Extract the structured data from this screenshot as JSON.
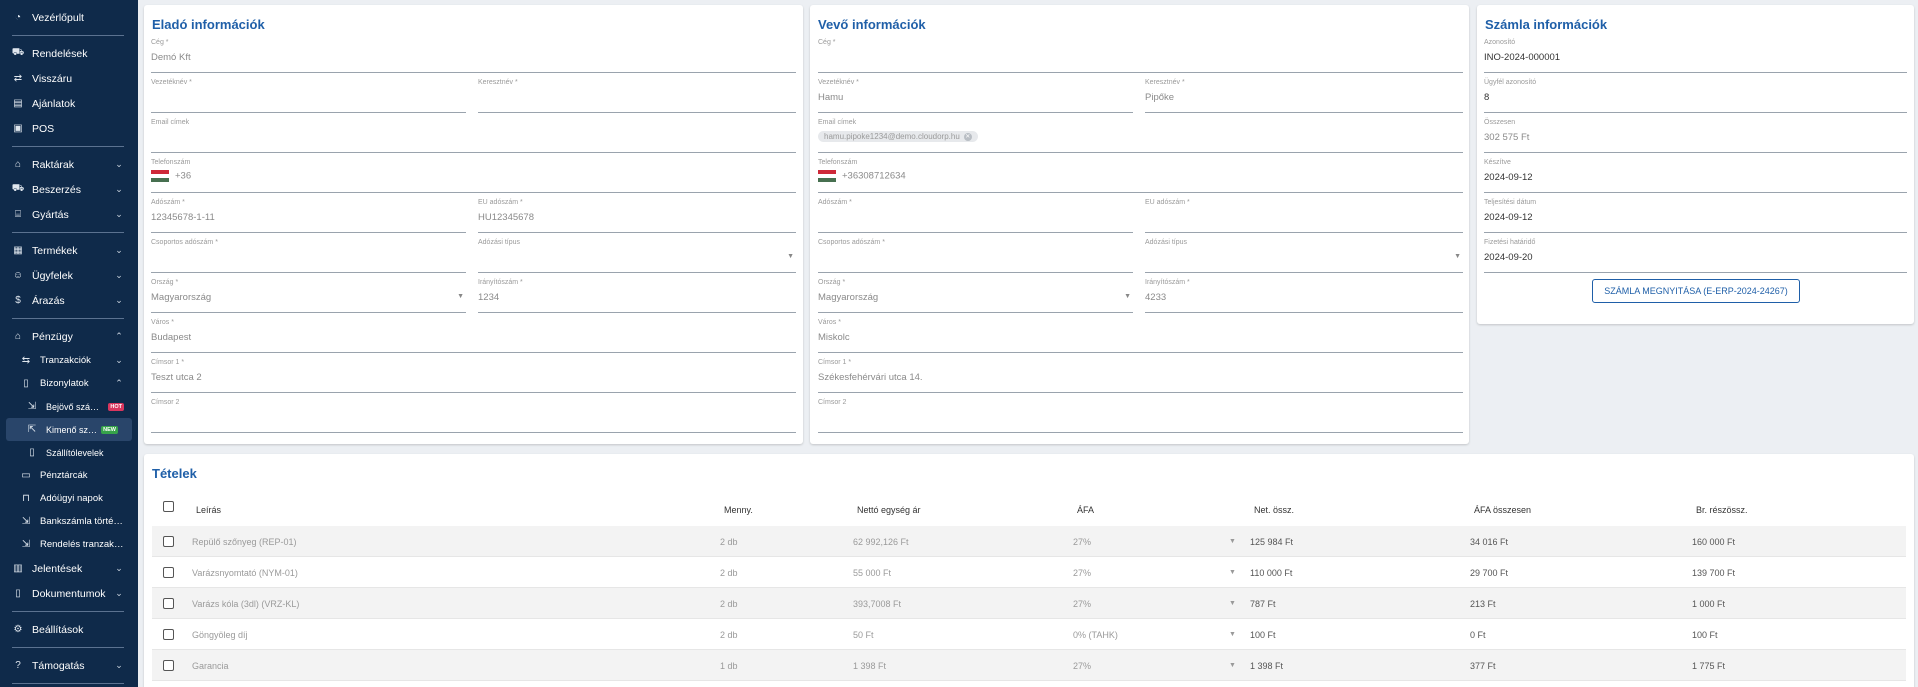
{
  "sidebar": {
    "items": [
      {
        "label": "Vezérlőpult",
        "icon": "dashboard-icon",
        "glyph": "◔"
      },
      {
        "label": "Rendelések",
        "icon": "cart-icon",
        "glyph": "⛟"
      },
      {
        "label": "Visszáru",
        "icon": "swap-icon",
        "glyph": "⇄"
      },
      {
        "label": "Ajánlatok",
        "icon": "document-icon",
        "glyph": "▤"
      },
      {
        "label": "POS",
        "icon": "pos-icon",
        "glyph": "▣"
      },
      {
        "label": "Raktárak",
        "icon": "warehouse-icon",
        "glyph": "⌂"
      },
      {
        "label": "Beszerzés",
        "icon": "truck-icon",
        "glyph": "⛟"
      },
      {
        "label": "Gyártás",
        "icon": "factory-icon",
        "glyph": "⌸"
      },
      {
        "label": "Termékek",
        "icon": "products-icon",
        "glyph": "▦"
      },
      {
        "label": "Ügyfelek",
        "icon": "customers-icon",
        "glyph": "☺"
      },
      {
        "label": "Árazás",
        "icon": "dollar-icon",
        "glyph": "$"
      },
      {
        "label": "Pénzügy",
        "icon": "bank-icon",
        "glyph": "⌂"
      },
      {
        "label": "Tranzakciók",
        "icon": "transactions-icon",
        "glyph": "⇆"
      },
      {
        "label": "Bizonylatok",
        "icon": "receipt-icon",
        "glyph": "▯"
      },
      {
        "label": "Bejövő számlák",
        "icon": "incoming-invoice-icon",
        "glyph": "⇲",
        "badge": "HOT"
      },
      {
        "label": "Kimenő szám",
        "icon": "outgoing-invoice-icon",
        "glyph": "⇱",
        "badge": "NEW"
      },
      {
        "label": "Szállítólevelek",
        "icon": "delivery-note-icon",
        "glyph": "▯"
      },
      {
        "label": "Pénztárcák",
        "icon": "wallet-icon",
        "glyph": "▭"
      },
      {
        "label": "Adóügyi napok",
        "icon": "lock-icon",
        "glyph": "⊓"
      },
      {
        "label": "Bankszámla történ...",
        "icon": "bank-history-icon",
        "glyph": "⇲"
      },
      {
        "label": "Rendelés tranzakc...",
        "icon": "order-transaction-icon",
        "glyph": "⇲"
      },
      {
        "label": "Jelentések",
        "icon": "reports-icon",
        "glyph": "▥"
      },
      {
        "label": "Dokumentumok",
        "icon": "documents-icon",
        "glyph": "▯"
      },
      {
        "label": "Beállítások",
        "icon": "gear-icon",
        "glyph": "⚙"
      },
      {
        "label": "Támogatás",
        "icon": "help-icon",
        "glyph": "?"
      }
    ]
  },
  "seller": {
    "title": "Eladó információk",
    "fields": [
      {
        "label": "Cég *",
        "value": "Demó Kft"
      },
      {
        "label": "Vezetéknév *",
        "value": ""
      },
      {
        "label": "Keresztnév *",
        "value": ""
      },
      {
        "label": "Email címek",
        "value": ""
      },
      {
        "label": "Telefonszám",
        "value": "+36"
      },
      {
        "label": "Adószám *",
        "value": "12345678-1-11"
      },
      {
        "label": "EU adószám *",
        "value": "HU12345678"
      },
      {
        "label": "Csoportos adószám *",
        "value": ""
      },
      {
        "label": "Adózási típus",
        "value": ""
      },
      {
        "label": "Ország *",
        "value": "Magyarország"
      },
      {
        "label": "Irányítószám *",
        "value": "1234"
      },
      {
        "label": "Város *",
        "value": "Budapest"
      },
      {
        "label": "Címsor 1 *",
        "value": "Teszt utca 2"
      },
      {
        "label": "Címsor 2",
        "value": ""
      }
    ]
  },
  "buyer": {
    "title": "Vevő információk",
    "fields": [
      {
        "label": "Cég *",
        "value": ""
      },
      {
        "label": "Vezetéknév *",
        "value": "Hamu"
      },
      {
        "label": "Keresztnév *",
        "value": "Pipőke"
      },
      {
        "label": "Email címek",
        "value": "hamu.pipoke1234@demo.cloudorp.hu"
      },
      {
        "label": "Telefonszám",
        "value": "+36308712634"
      },
      {
        "label": "Adószám *",
        "value": ""
      },
      {
        "label": "EU adószám *",
        "value": ""
      },
      {
        "label": "Csoportos adószám *",
        "value": ""
      },
      {
        "label": "Adózási típus",
        "value": ""
      },
      {
        "label": "Ország *",
        "value": "Magyarország"
      },
      {
        "label": "Irányítószám *",
        "value": "4233"
      },
      {
        "label": "Város *",
        "value": "Miskolc"
      },
      {
        "label": "Címsor 1 *",
        "value": "Székesfehérvári utca 14."
      },
      {
        "label": "Címsor 2",
        "value": ""
      }
    ]
  },
  "invoice": {
    "title": "Számla információk",
    "fields": [
      {
        "label": "Azonosító",
        "value": "INO-2024-000001"
      },
      {
        "label": "Ügyfél azonosító",
        "value": "8"
      },
      {
        "label": "Összesen",
        "value": "302 575 Ft"
      },
      {
        "label": "Készítve",
        "value": "2024-09-12"
      },
      {
        "label": "Teljesítési dátum",
        "value": "2024-09-12"
      },
      {
        "label": "Fizetési határidő",
        "value": "2024-09-20"
      }
    ],
    "open_button": "SZÁMLA MEGNYITÁSA (E-ERP-2024-24267)"
  },
  "items": {
    "title": "Tételek",
    "columns": [
      "Leírás",
      "Menny.",
      "Nettó egység ár",
      "ÁFA",
      "Net. össz.",
      "ÁFA összesen",
      "Br. részössz."
    ],
    "rows": [
      [
        "Repülő szőnyeg (REP-01)",
        "2 db",
        "62 992,126 Ft",
        "27%",
        "125 984 Ft",
        "34 016 Ft",
        "160 000 Ft"
      ],
      [
        "Varázsnyomtató (NYM-01)",
        "2 db",
        "55 000 Ft",
        "27%",
        "110 000 Ft",
        "29 700 Ft",
        "139 700 Ft"
      ],
      [
        "Varázs kóla (3dl) (VRZ-KL)",
        "2 db",
        "393,7008 Ft",
        "27%",
        "787 Ft",
        "213 Ft",
        "1 000 Ft"
      ],
      [
        "Göngyöleg díj",
        "2 db",
        "50 Ft",
        "0% (TAHK)",
        "100 Ft",
        "0 Ft",
        "100 Ft"
      ],
      [
        "Garancia",
        "1 db",
        "1 398 Ft",
        "27%",
        "1 398 Ft",
        "377 Ft",
        "1 775 Ft"
      ]
    ]
  },
  "colors": {
    "sidebar_bg": "#0f2a4a",
    "accent": "#1f5fa8",
    "hot_badge": "#d9365e",
    "new_badge": "#36a34a"
  }
}
